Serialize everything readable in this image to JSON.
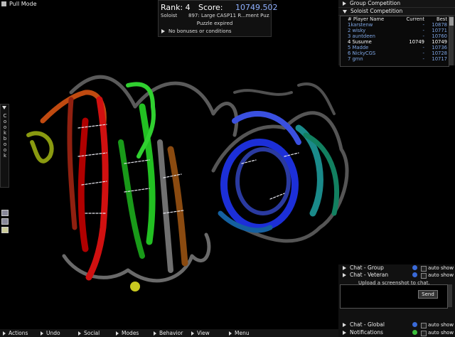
{
  "game": {
    "pull_mode": "Pull Mode"
  },
  "score_panel": {
    "rank": "Rank: 4",
    "score_label": "Score:",
    "score_value": "10749.502",
    "mode": "Soloist",
    "puzzle": "897: Large CASP11 R...ment Puzzle: TR760",
    "status": "Puzzle expired",
    "bonuses": "No bonuses or conditions"
  },
  "competition": {
    "group_label": "Group Competition",
    "soloist_label": "Soloist Competition",
    "columns": [
      "# Player Name",
      "Current",
      "Best"
    ],
    "rows": [
      {
        "name": "1karstenw",
        "current": "-",
        "best": "10878"
      },
      {
        "name": "2 wisky",
        "current": "-",
        "best": "10771"
      },
      {
        "name": "3 auntdeen",
        "current": "-",
        "best": "10760"
      },
      {
        "name": "4 Susume",
        "current": "10749",
        "best": "10749"
      },
      {
        "name": "5 Madde",
        "current": "-",
        "best": "10736"
      },
      {
        "name": "6 NickyCGS",
        "current": "-",
        "best": "10728"
      },
      {
        "name": "7 gmn",
        "current": "-",
        "best": "10717"
      }
    ]
  },
  "cookbook": {
    "label": "C\no\no\nk\nb\no\no\nk"
  },
  "chat": {
    "group": "Chat - Group",
    "veteran": "Chat - Veteran",
    "global": "Chat - Global",
    "notifications": "Notifications",
    "auto_show": "auto show",
    "message": "Upload a screenshot to chat.",
    "send": "Send"
  },
  "toolbar": {
    "items": [
      "Actions",
      "Undo",
      "Social",
      "Modes",
      "Behavior",
      "View",
      "Menu"
    ]
  },
  "colors": {
    "accent": "#7fa7e6",
    "info": "#3a6ad8",
    "notify": "#3bbf3b"
  }
}
